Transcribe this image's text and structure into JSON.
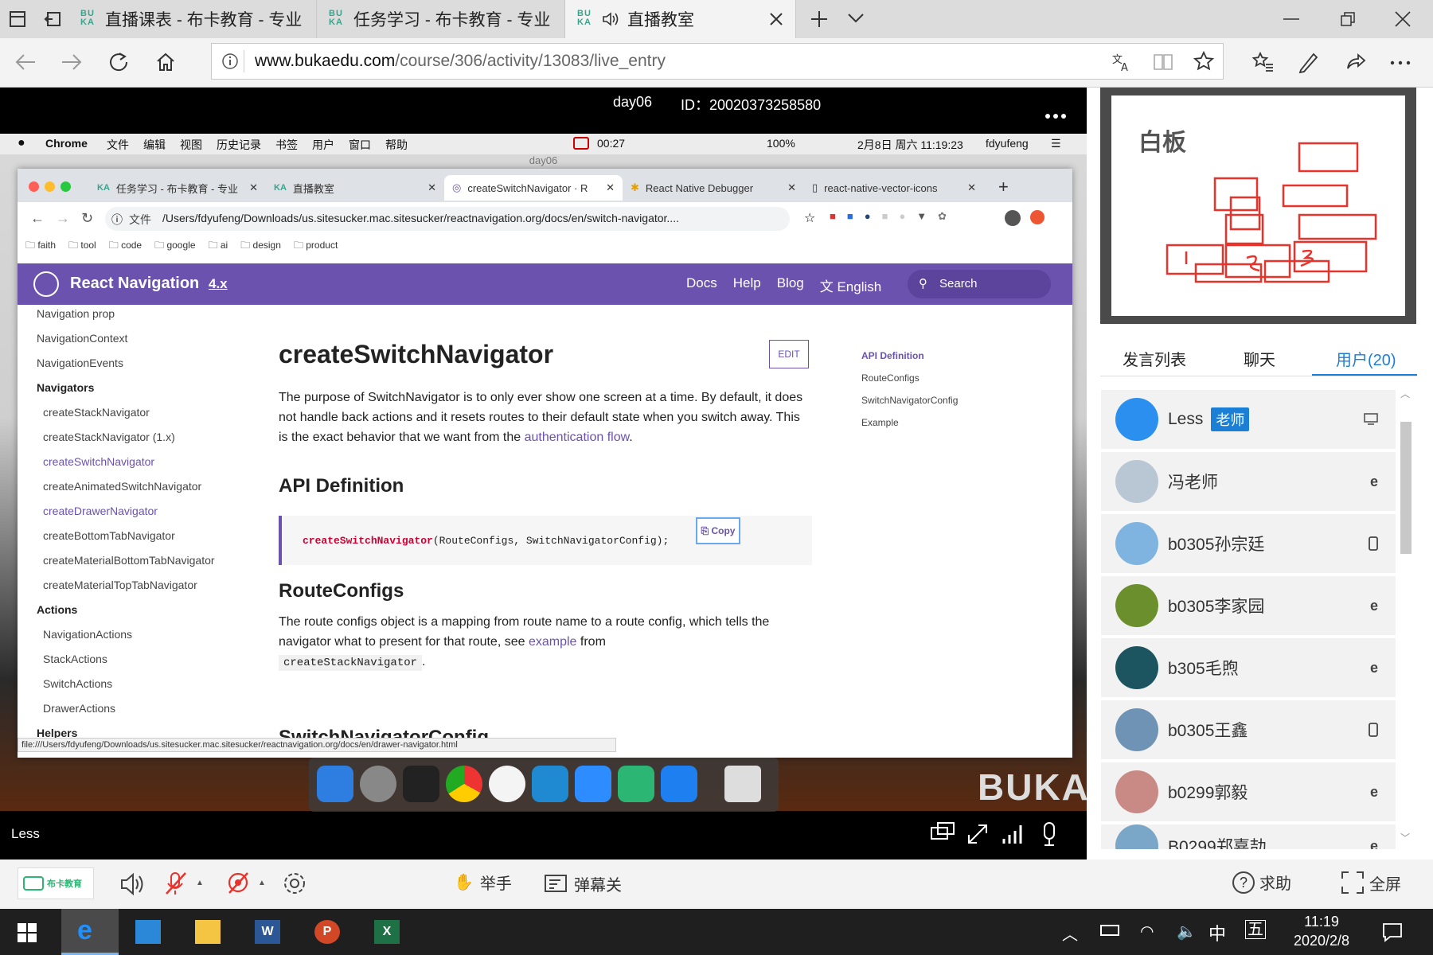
{
  "edge": {
    "tabs": [
      {
        "title": "直播课表 - 布卡教育 - 专业"
      },
      {
        "title": "任务学习 - 布卡教育 - 专业"
      },
      {
        "title": "直播教室"
      }
    ],
    "url_host": "www.bukaedu.com",
    "url_path": "/course/306/activity/13083/live_entry"
  },
  "player": {
    "title": "day06",
    "id_label": "ID：",
    "id_value": "20020373258580",
    "presenter": "Less"
  },
  "mac": {
    "app": "Chrome",
    "menus": [
      "文件",
      "编辑",
      "视图",
      "历史记录",
      "书签",
      "用户",
      "窗口",
      "帮助"
    ],
    "record_time": "00:27",
    "battery": "100%",
    "datetime": "2月8日 周六 11:19:23",
    "username": "fdyufeng",
    "window_title": "day06"
  },
  "chrome": {
    "tabs": [
      "任务学习 - 布卡教育 - 专业",
      "直播教室",
      "createSwitchNavigator · R",
      "React Native Debugger",
      "react-native-vector-icons"
    ],
    "file_label": "文件",
    "address": "/Users/fdyufeng/Downloads/us.sitesucker.mac.sitesucker/reactnavigation.org/docs/en/switch-navigator....",
    "bookmarks": [
      "faith",
      "tool",
      "code",
      "google",
      "ai",
      "design",
      "product"
    ],
    "status_url": "file:///Users/fdyufeng/Downloads/us.sitesucker.mac.sitesucker/reactnavigation.org/docs/en/drawer-navigator.html"
  },
  "docs": {
    "brand": "React Navigation",
    "version": "4.x",
    "nav": [
      "Docs",
      "Help",
      "Blog"
    ],
    "lang": "English",
    "search_placeholder": "Search",
    "sidebar": [
      {
        "text": "Navigation prop",
        "type": "item"
      },
      {
        "text": "NavigationContext",
        "type": "item"
      },
      {
        "text": "NavigationEvents",
        "type": "item"
      },
      {
        "text": "Navigators",
        "type": "heading"
      },
      {
        "text": "createStackNavigator",
        "type": "sub"
      },
      {
        "text": "createStackNavigator (1.x)",
        "type": "sub"
      },
      {
        "text": "createSwitchNavigator",
        "type": "sub-active"
      },
      {
        "text": "createAnimatedSwitchNavigator",
        "type": "sub"
      },
      {
        "text": "createDrawerNavigator",
        "type": "sub-hover"
      },
      {
        "text": "createBottomTabNavigator",
        "type": "sub"
      },
      {
        "text": "createMaterialBottomTabNavigator",
        "type": "sub"
      },
      {
        "text": "createMaterialTopTabNavigator",
        "type": "sub"
      },
      {
        "text": "Actions",
        "type": "heading"
      },
      {
        "text": "NavigationActions",
        "type": "sub"
      },
      {
        "text": "StackActions",
        "type": "sub"
      },
      {
        "text": "SwitchActions",
        "type": "sub"
      },
      {
        "text": "DrawerActions",
        "type": "sub"
      },
      {
        "text": "Helpers",
        "type": "heading"
      }
    ],
    "page_title": "createSwitchNavigator",
    "edit_label": "EDIT",
    "intro_text": "The purpose of SwitchNavigator is to only ever show one screen at a time. By default, it does not handle back actions and it resets routes to their default state when you switch away. This is the exact behavior that we want from the",
    "intro_link": "authentication flow",
    "intro_end": ".",
    "api_heading": "API Definition",
    "code_fn": "createSwitchNavigator",
    "code_args": "(RouteConfigs, SwitchNavigatorConfig);",
    "copy_label": "Copy",
    "route_heading": "RouteConfigs",
    "route_text": "The route configs object is a mapping from route name to a route config, which tells the navigator what to present for that route, see",
    "route_link": "example",
    "route_after": "from",
    "route_code": "createStackNavigator",
    "route_end": ".",
    "next_heading_partial": "SwitchNavigatorConfig",
    "toc": [
      "API Definition",
      "RouteConfigs",
      "SwitchNavigatorConfig",
      "Example"
    ]
  },
  "whiteboard": {
    "title": "白板"
  },
  "panel": {
    "tabs": [
      "发言列表",
      "聊天",
      "用户(20)"
    ],
    "users": [
      {
        "name": "Less",
        "badge": "老师",
        "device": "desktop-icon",
        "color": "#2b8ff0"
      },
      {
        "name": "冯老师",
        "badge": "",
        "device": "ie-icon",
        "color": "#b8c7d3"
      },
      {
        "name": "b0305孙宗廷",
        "badge": "",
        "device": "phone-icon",
        "color": "#7fb4e0"
      },
      {
        "name": "b0305李家园",
        "badge": "",
        "device": "ie-icon",
        "color": "#6a8f2c"
      },
      {
        "name": "b305毛煦",
        "badge": "",
        "device": "ie-icon",
        "color": "#1c5560"
      },
      {
        "name": "b0305王鑫",
        "badge": "",
        "device": "phone-icon",
        "color": "#6f93b4"
      },
      {
        "name": "b0299郭毅",
        "badge": "",
        "device": "ie-icon",
        "color": "#c98a86"
      },
      {
        "name": "B0299郑嘉劼",
        "badge": "",
        "device": "ie-icon",
        "color": "#7aa6c8"
      }
    ]
  },
  "controls": {
    "brand": "布卡教育",
    "raise_hand": "举手",
    "danmu": "弹幕关",
    "help": "求助",
    "fullscreen": "全屏"
  },
  "taskbar": {
    "time": "11:19",
    "date": "2020/2/8",
    "ime1": "中",
    "ime2": "五"
  }
}
